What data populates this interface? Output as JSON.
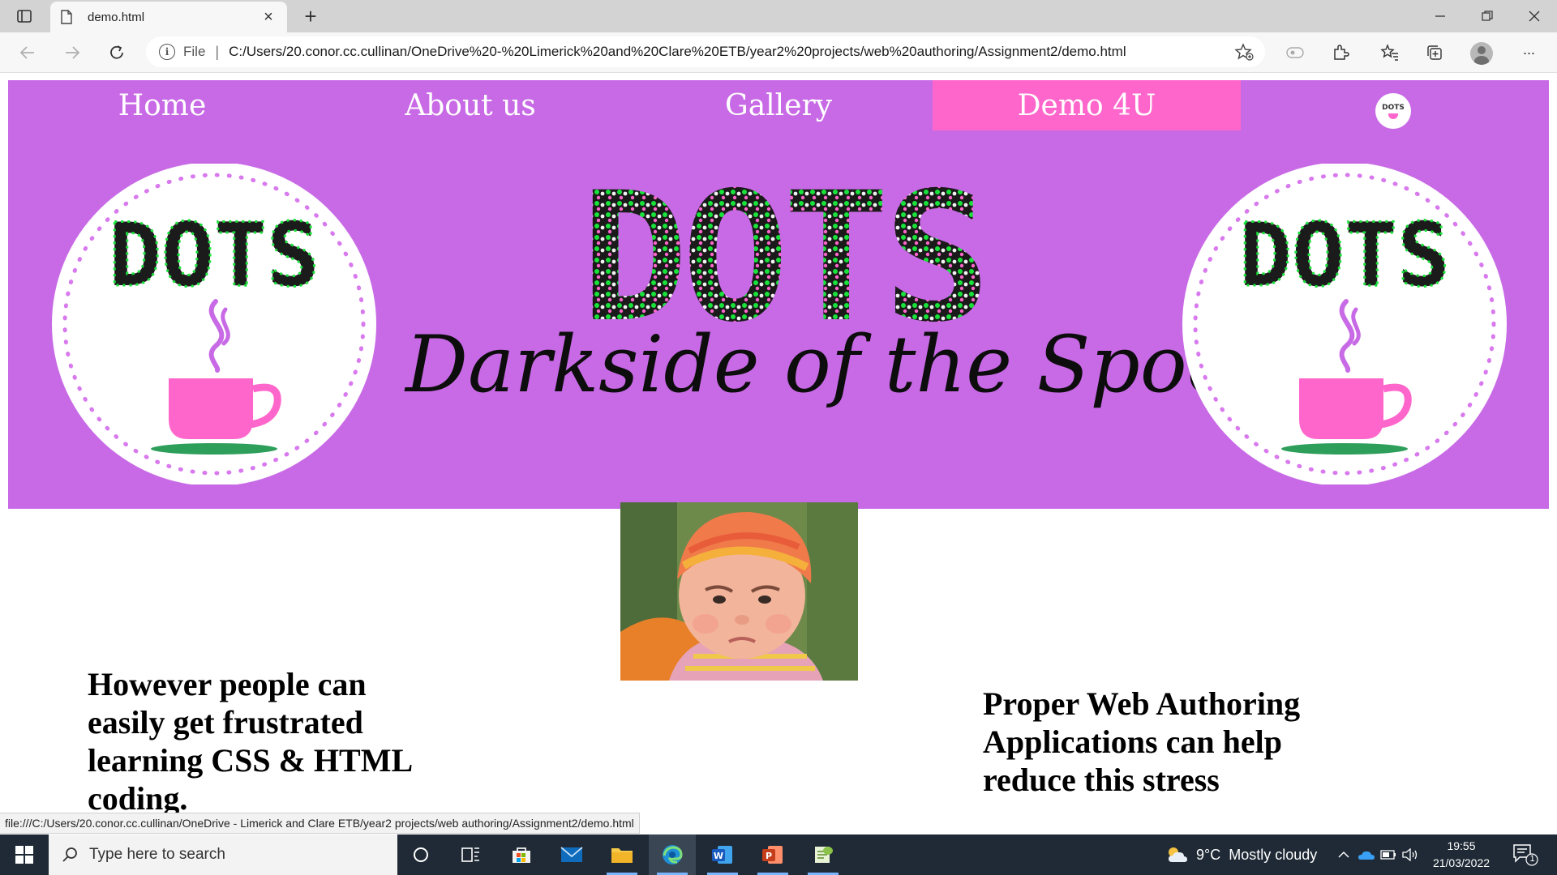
{
  "browser": {
    "tab_title": "demo.html",
    "new_tab_symbol": "+",
    "close_symbol": "×",
    "address_scheme": "File",
    "address_separator": "|",
    "url": "C:/Users/20.conor.cc.cullinan/OneDrive%20-%20Limerick%20and%20Clare%20ETB/year2%20projects/web%20authoring/Assignment2/demo.html",
    "status_url": "file:///C:/Users/20.conor.cc.cullinan/OneDrive - Limerick and Clare ETB/year2 projects/web authoring/Assignment2/demo.html",
    "more_symbol": "···",
    "icons": [
      "page-icon",
      "back-arrow-icon",
      "forward-arrow-icon",
      "refresh-icon",
      "info-icon",
      "star-plus-icon",
      "extensions-icon",
      "favorites-icon",
      "collections-icon",
      "profile-icon",
      "more-icon",
      "minimize-icon",
      "maximize-icon",
      "close-icon"
    ]
  },
  "site": {
    "nav": [
      {
        "label": "Home"
      },
      {
        "label": "About us"
      },
      {
        "label": "Gallery"
      },
      {
        "label": "Demo 4U",
        "active": true
      }
    ],
    "logo_text": "DOTS",
    "banner_title": "DOTS",
    "banner_tagline": "Darkside of the Spoon",
    "left_text": "However people can easily get frustrated learning CSS & HTML coding.",
    "right_text": "Proper Web Authoring Applications can help reduce this stress",
    "colors": {
      "header_bg": "#c86ae6",
      "active_nav": "#ff66cc",
      "cup": "#ff66cc",
      "saucer": "#2e9e5b",
      "dots_green": "#19e33a"
    }
  },
  "taskbar": {
    "search_placeholder": "Type here to search",
    "weather_temp": "9°C",
    "weather_desc": "Mostly cloudy",
    "time": "19:55",
    "date": "21/03/2022",
    "notification_count": "1",
    "apps": [
      "task-view-icon",
      "widgets-icon",
      "microsoft-store-icon",
      "mail-icon",
      "file-explorer-icon",
      "edge-icon",
      "word-icon",
      "powerpoint-icon",
      "notepad-plus-plus-icon"
    ]
  }
}
